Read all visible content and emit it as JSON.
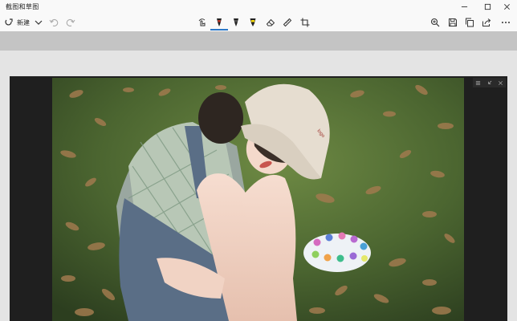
{
  "app": {
    "title": "截图和草图"
  },
  "toolbar": {
    "new_label": "新建",
    "icons": [
      "snip-icon",
      "chevron-down-icon",
      "undo-icon",
      "redo-icon",
      "touch-writing-icon",
      "ballpoint-pen-icon",
      "pencil-icon",
      "highlighter-icon",
      "eraser-icon",
      "ruler-icon",
      "crop-icon",
      "zoom-in-icon",
      "save-icon",
      "copy-icon",
      "share-icon",
      "more-icon"
    ],
    "pen_colors": {
      "ballpoint": "#c0392b",
      "pencil": "#333333",
      "highlighter": "#f5d90a"
    }
  },
  "window_controls": [
    "minimize-icon",
    "maximize-icon",
    "close-icon"
  ],
  "colors": {
    "accent": "#2b78c8",
    "titlebar": "#f9f9f9",
    "workspace": "#e4e4e4",
    "frame": "#1f1f1f"
  }
}
